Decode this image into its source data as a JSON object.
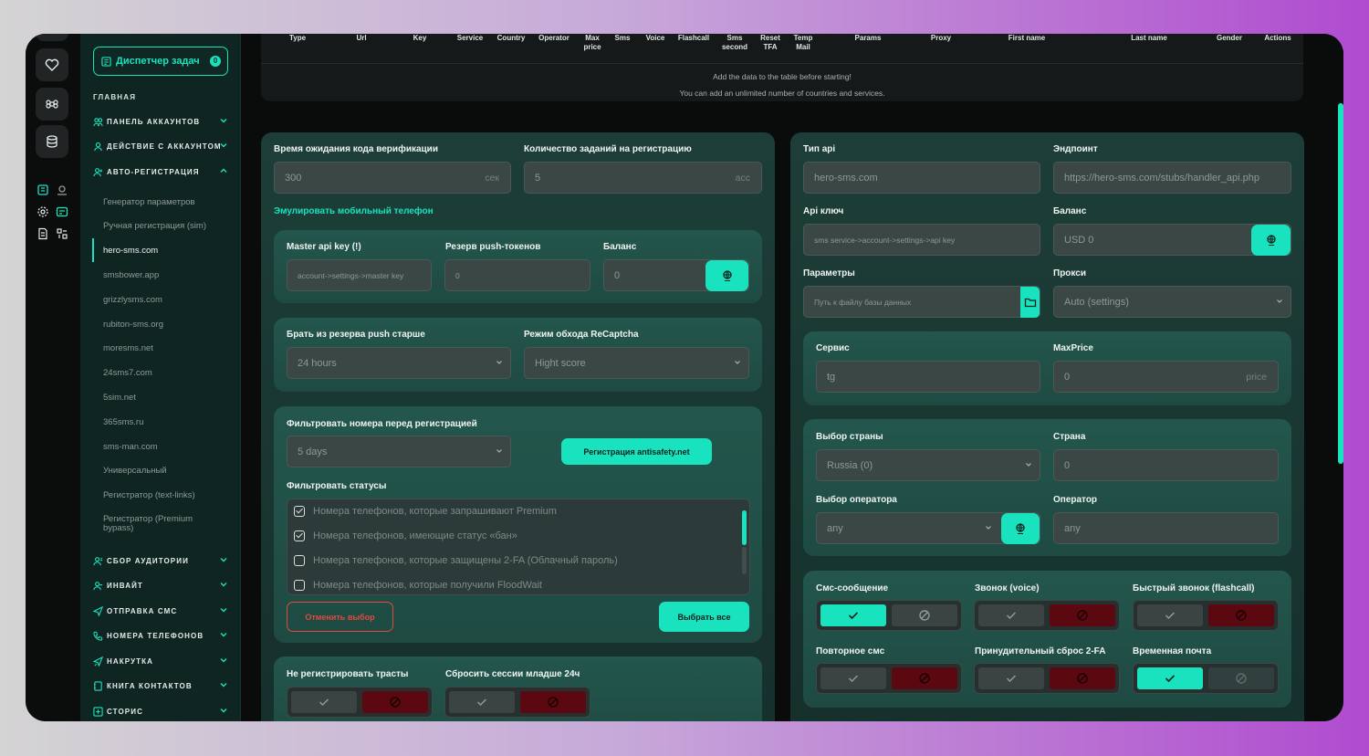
{
  "sidebar": {
    "task_button": {
      "label": "Диспетчер задач",
      "count": "0"
    },
    "section_title": "ГЛАВНАЯ",
    "groups_top": [
      {
        "label": "ПАНЕЛЬ АККАУНТОВ"
      },
      {
        "label": "ДЕЙСТВИЕ С АККАУНТОМ"
      },
      {
        "label": "АВТО-РЕГИСТРАЦИЯ"
      }
    ],
    "items": [
      {
        "label": "Генератор параметров"
      },
      {
        "label": "Ручная регистрация (sim)"
      },
      {
        "label": "hero-sms.com"
      },
      {
        "label": "smsbower.app"
      },
      {
        "label": "grizzlysms.com"
      },
      {
        "label": "rubiton-sms.org"
      },
      {
        "label": "moresms.net"
      },
      {
        "label": "24sms7.com"
      },
      {
        "label": "5sim.net"
      },
      {
        "label": "365sms.ru"
      },
      {
        "label": "sms-man.com"
      },
      {
        "label": "Универсальный"
      },
      {
        "label": "Регистратор (text-links)"
      },
      {
        "label": "Регистратор (Premium bypass)"
      }
    ],
    "groups_bottom": [
      {
        "label": "СБОР АУДИТОРИИ"
      },
      {
        "label": "ИНВАЙТ"
      },
      {
        "label": "ОТПРАВКА СМС"
      },
      {
        "label": "НОМЕРА ТЕЛЕФОНОВ"
      },
      {
        "label": "НАКРУТКА"
      },
      {
        "label": "КНИГА КОНТАКТОВ"
      },
      {
        "label": "СТОРИС"
      }
    ]
  },
  "table": {
    "columns": [
      "Type",
      "Url",
      "Key",
      "Service",
      "Country",
      "Operator",
      "Max price",
      "Sms",
      "Voice",
      "Flashcall",
      "Sms second",
      "Reset TFA",
      "Temp Mail",
      "Params",
      "Proxy",
      "First name",
      "Last name",
      "Gender",
      "Actions"
    ],
    "note_1": "Add the data to the table before starting!",
    "note_2": "You can add an unlimited number of countries and services."
  },
  "left": {
    "wait_label": "Время ожидания кода верификации",
    "wait_value": "300",
    "wait_suffix": "сек",
    "tasks_label": "Количество заданий на регистрацию",
    "tasks_value": "5",
    "tasks_suffix": "acc",
    "emulate_label": "Эмулировать мобильный телефон",
    "master_key_label": "Master api key (!)",
    "master_key_placeholder": "account->settings->master key",
    "push_reserve_label": "Резерв push-токенов",
    "push_reserve_value": "0",
    "balance_label": "Баланс",
    "balance_value": "0",
    "push_older_label": "Брать из резерва push старше",
    "push_older_value": "24 hours",
    "recaptcha_label": "Режим обхода ReCaptcha",
    "recaptcha_value": "Hight score",
    "filter_label": "Фильтровать номера перед регистрацией",
    "filter_value": "5 days",
    "antisafety_button": "Регистрация antisafety.net",
    "statuses_label": "Фильтровать статусы",
    "statuses": [
      {
        "label": "Номера телефонов, которые запрашивают Premium",
        "checked": true
      },
      {
        "label": "Номера телефонов, имеющие статус «бан»",
        "checked": true
      },
      {
        "label": "Номера телефонов, которые защищены 2-FA (Облачный пароль)",
        "checked": false
      },
      {
        "label": "Номера телефонов, которые получили FloodWait",
        "checked": false
      }
    ],
    "cancel_button": "Отменить выбор",
    "select_all_button": "Выбрать все",
    "no_trust_label": "Не регистрировать трасты",
    "reset_sessions_label": "Сбросить сессии младше 24ч"
  },
  "right": {
    "api_type_label": "Тип api",
    "api_type_value": "hero-sms.com",
    "endpoint_label": "Эндпоинт",
    "endpoint_value": "https://hero-sms.com/stubs/handler_api.php",
    "api_key_label": "Api ключ",
    "api_key_placeholder": "sms service->account->settings->api key",
    "balance_label": "Баланс",
    "balance_value": "USD  0",
    "params_label": "Параметры",
    "params_placeholder": "Путь к файлу базы данных",
    "proxy_label": "Прокси",
    "proxy_value": "Auto (settings)",
    "service_label": "Сервис",
    "service_value": "tg",
    "maxprice_label": "MaxPrice",
    "maxprice_value": "0",
    "maxprice_suffix": "price",
    "country_select_label": "Выбор страны",
    "country_select_value": "Russia (0)",
    "country_label": "Страна",
    "country_value": "0",
    "operator_select_label": "Выбор оператора",
    "operator_select_value": "any",
    "operator_label": "Оператор",
    "operator_value": "any",
    "sms_label": "Смс-сообщение",
    "voice_label": "Звонок (voice)",
    "flashcall_label": "Быстрый звонок (flashcall)",
    "repeat_sms_label": "Повторное смс",
    "reset_2fa_label": "Принудительный сброс 2-FA",
    "temp_mail_label": "Временная почта"
  },
  "toggles": {
    "sms": true,
    "voice": false,
    "flashcall": false,
    "repeat_sms": false,
    "reset_2fa": false,
    "temp_mail": true,
    "no_trust": false,
    "reset_sessions": false
  },
  "colors": {
    "accent": "#19e3be",
    "danger": "#e04a3f",
    "danger_fill": "#5b0810",
    "panel": "#1d3e38"
  }
}
